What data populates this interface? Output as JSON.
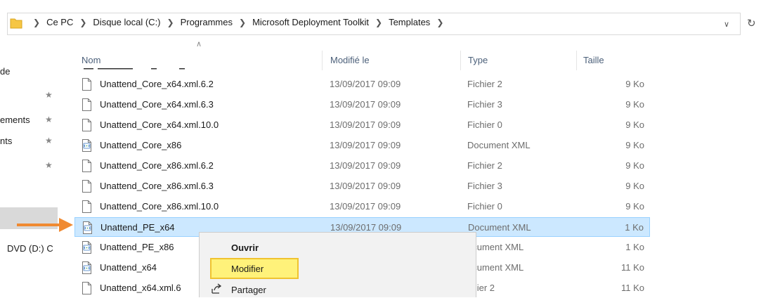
{
  "breadcrumb": [
    "Ce PC",
    "Disque local (C:)",
    "Programmes",
    "Microsoft Deployment Toolkit",
    "Templates"
  ],
  "nav": {
    "items": [
      "de",
      "ements",
      "nts",
      "DVD (D:) C"
    ]
  },
  "columns": {
    "name": "Nom",
    "modified": "Modifié le",
    "type": "Type",
    "size": "Taille"
  },
  "files": [
    {
      "name": "Unattend_Core_x64.xml.6.2",
      "date": "13/09/2017 09:09",
      "type": "Fichier 2",
      "size": "9 Ko",
      "icon": "blank-file-icon"
    },
    {
      "name": "Unattend_Core_x64.xml.6.3",
      "date": "13/09/2017 09:09",
      "type": "Fichier 3",
      "size": "9 Ko",
      "icon": "blank-file-icon"
    },
    {
      "name": "Unattend_Core_x64.xml.10.0",
      "date": "13/09/2017 09:09",
      "type": "Fichier 0",
      "size": "9 Ko",
      "icon": "blank-file-icon"
    },
    {
      "name": "Unattend_Core_x86",
      "date": "13/09/2017 09:09",
      "type": "Document XML",
      "size": "9 Ko",
      "icon": "xml-file-icon"
    },
    {
      "name": "Unattend_Core_x86.xml.6.2",
      "date": "13/09/2017 09:09",
      "type": "Fichier 2",
      "size": "9 Ko",
      "icon": "blank-file-icon"
    },
    {
      "name": "Unattend_Core_x86.xml.6.3",
      "date": "13/09/2017 09:09",
      "type": "Fichier 3",
      "size": "9 Ko",
      "icon": "blank-file-icon"
    },
    {
      "name": "Unattend_Core_x86.xml.10.0",
      "date": "13/09/2017 09:09",
      "type": "Fichier 0",
      "size": "9 Ko",
      "icon": "blank-file-icon"
    },
    {
      "name": "Unattend_PE_x64",
      "date": "13/09/2017 09:09",
      "type": "Document XML",
      "size": "1 Ko",
      "icon": "xml-file-icon",
      "selected": true
    },
    {
      "name": "Unattend_PE_x86",
      "date": "",
      "type": "ocument XML",
      "size": "1 Ko",
      "icon": "xml-file-icon"
    },
    {
      "name": "Unattend_x64",
      "date": "",
      "type": "ocument XML",
      "size": "11 Ko",
      "icon": "xml-file-icon"
    },
    {
      "name": "Unattend_x64.xml.6",
      "date": "",
      "type": "chier 2",
      "size": "11 Ko",
      "icon": "blank-file-icon"
    }
  ],
  "context_menu": {
    "open": "Ouvrir",
    "edit": "Modifier",
    "share": "Partager"
  },
  "colors": {
    "selection": "#cce8ff",
    "highlight": "#fff27a",
    "arrow": "#f08a32",
    "folder": "#f6c644"
  }
}
